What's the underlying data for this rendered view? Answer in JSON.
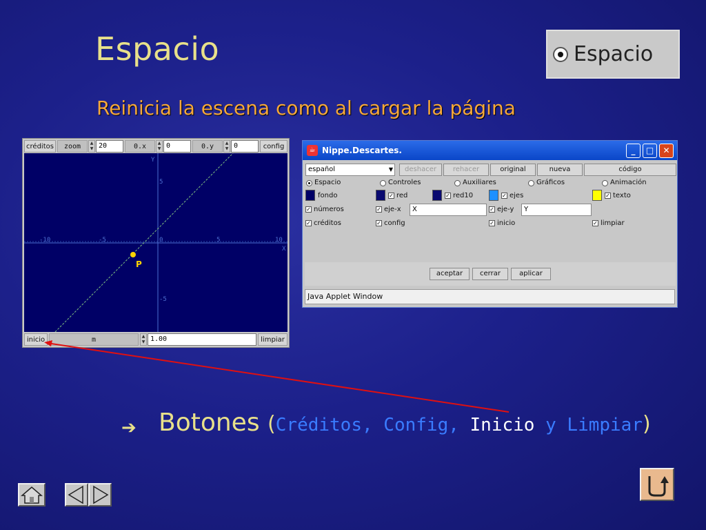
{
  "slide": {
    "title": "Espacio",
    "subtitle": "Reinicia la escena como al cargar la página",
    "thumbnail_label": "Espacio"
  },
  "applet": {
    "toolbar": {
      "creditos": "créditos",
      "zoom_label": "zoom",
      "zoom_value": "20",
      "ox_label": "0.x",
      "ox_value": "0",
      "oy_label": "0.y",
      "oy_value": "0",
      "config": "config"
    },
    "axes": {
      "y_label": "Y",
      "x_label": "X",
      "x_ticks": [
        "-10",
        "-5",
        "0",
        "5",
        "10"
      ],
      "y_ticks": [
        "5",
        "-5"
      ]
    },
    "point_label": "P",
    "bottom": {
      "inicio": "inicio",
      "m_label": "m",
      "m_value": "1.00",
      "limpiar": "limpiar"
    },
    "colors": {
      "background": "#000066",
      "line": "#7fbf7f",
      "point": "#ffd400"
    }
  },
  "java_window": {
    "title": "Nippe.Descartes.",
    "language": "español",
    "buttons": [
      "deshacer",
      "rehacer",
      "original",
      "nueva",
      "código"
    ],
    "tabs": [
      "Espacio",
      "Controles",
      "Auxiliares",
      "Gráficos",
      "Animación"
    ],
    "swatches": {
      "fondo": "fondo",
      "red": "red",
      "red10": "red10",
      "ejes": "ejes",
      "texto": "texto"
    },
    "checks": {
      "numeros": "números",
      "ejex": "eje-x",
      "ejex_value": "X",
      "ejey": "eje-y",
      "ejey_value": "Y",
      "creditos": "créditos",
      "config": "config",
      "inicio": "inicio",
      "limpiar": "limpiar"
    },
    "actions": [
      "aceptar",
      "cerrar",
      "aplicar"
    ],
    "status": "Java Applet Window"
  },
  "bullet": {
    "main": "Botones",
    "open": "(",
    "items_a": "Créditos, Config, ",
    "item_hi": "Inicio",
    "items_b": " y Limpiar",
    "close": ")"
  }
}
